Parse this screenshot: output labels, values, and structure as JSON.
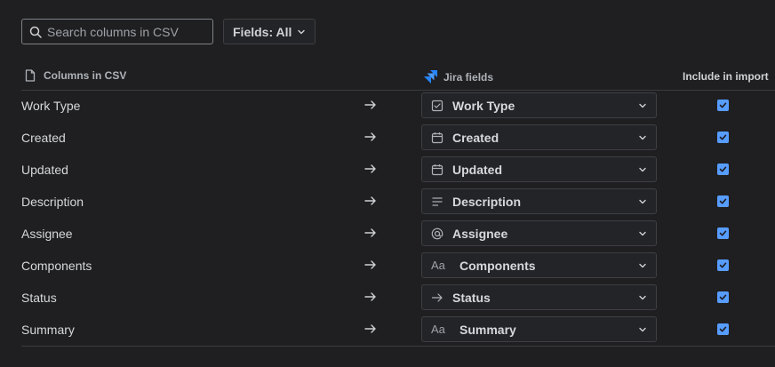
{
  "toolbar": {
    "search_placeholder": "Search columns in CSV",
    "fields_button_label": "Fields: All"
  },
  "header": {
    "csv_column": "Columns in CSV",
    "jira_column": "Jira fields",
    "include_column": "Include in import"
  },
  "colors": {
    "background": "#1f1f21",
    "accent_checkbox": "#579dff",
    "jira_logo": "#2684ff"
  },
  "rows": [
    {
      "csv": "Work Type",
      "field": "Work Type",
      "icon": "checkbox-icon",
      "included": true
    },
    {
      "csv": "Created",
      "field": "Created",
      "icon": "calendar-icon",
      "included": true
    },
    {
      "csv": "Updated",
      "field": "Updated",
      "icon": "calendar-icon",
      "included": true
    },
    {
      "csv": "Description",
      "field": "Description",
      "icon": "text-lines-icon",
      "included": true
    },
    {
      "csv": "Assignee",
      "field": "Assignee",
      "icon": "at-sign-icon",
      "included": true
    },
    {
      "csv": "Components",
      "field": "Components",
      "icon": "text-aa-icon",
      "icon_text": "Aa",
      "included": true
    },
    {
      "csv": "Status",
      "field": "Status",
      "icon": "arrow-right-icon",
      "included": true
    },
    {
      "csv": "Summary",
      "field": "Summary",
      "icon": "text-aa-icon",
      "icon_text": "Aa",
      "included": true
    }
  ]
}
